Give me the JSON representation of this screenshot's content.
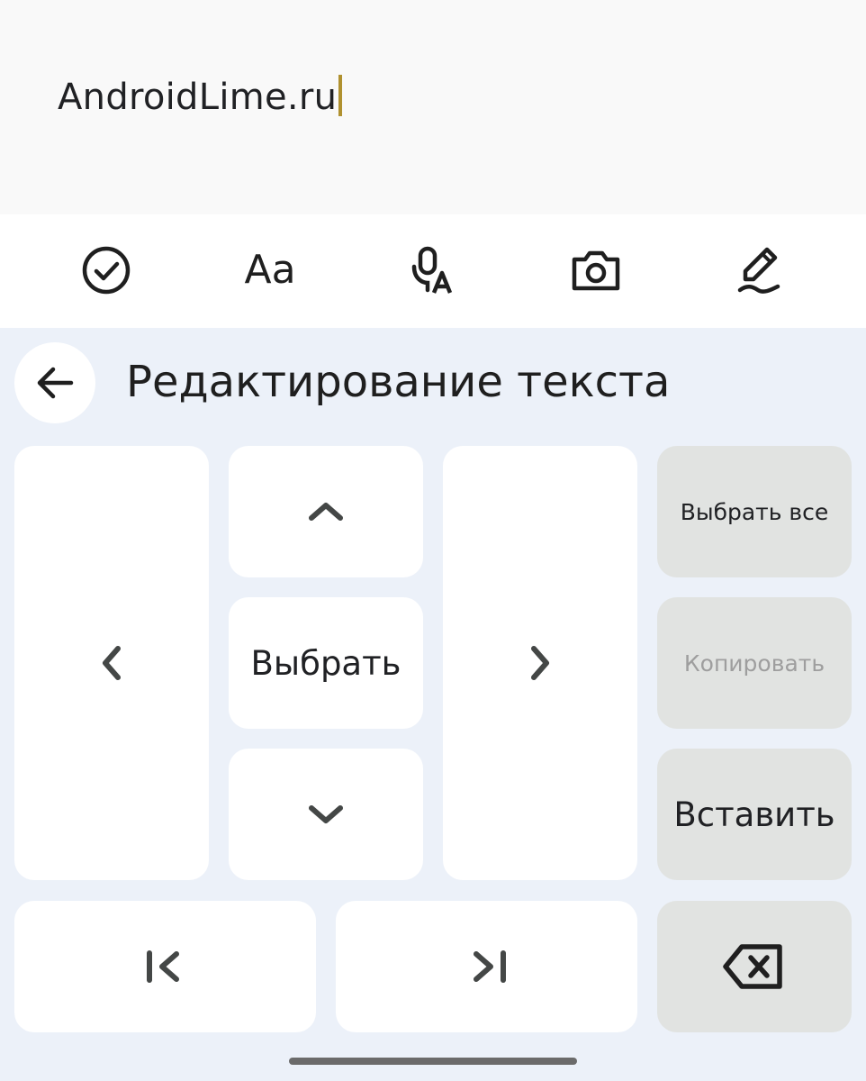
{
  "text_field": {
    "value": "AndroidLime.ru"
  },
  "toolbar": {
    "items": [
      {
        "icon": "check-circle-icon"
      },
      {
        "icon": "text-format-icon",
        "label": "Aa"
      },
      {
        "icon": "voice-translate-icon"
      },
      {
        "icon": "camera-icon"
      },
      {
        "icon": "handwriting-pen-icon"
      }
    ]
  },
  "panel": {
    "title": "Редактирование текста",
    "back_icon": "arrow-left-icon"
  },
  "keys": {
    "select_label": "Выбрать",
    "select_all_label": "Выбрать все",
    "copy_label": "Копировать",
    "paste_label": "Вставить"
  },
  "colors": {
    "cursor": "#b0912f",
    "keyboard_bg": "#ecf1f9",
    "key_bg": "#ffffff",
    "action_key_bg": "#e1e3e1",
    "disabled_text": "#9e9e9e"
  }
}
